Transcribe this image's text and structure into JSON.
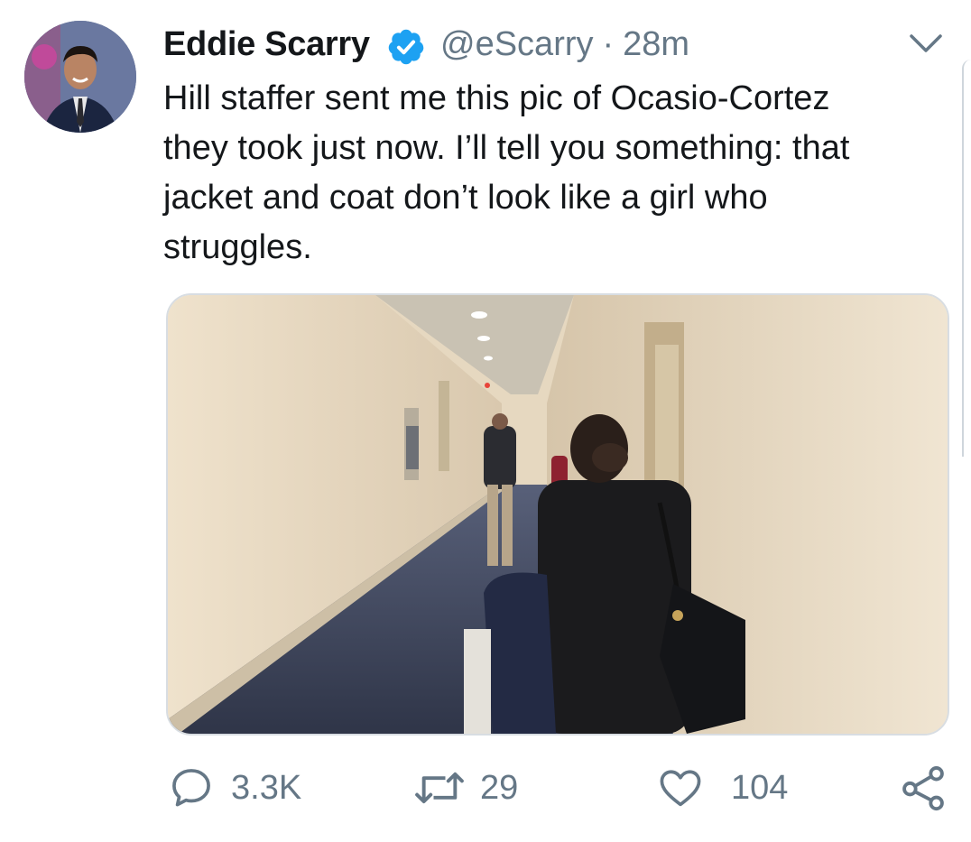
{
  "tweet": {
    "author_name": "Eddie Scarry",
    "handle": "@eScarry",
    "separator": "·",
    "time": "28m",
    "text_lines": [
      "Hill staffer sent me this pic of Ocasio-Cortez",
      "they took just now. I’ll tell you something: that",
      "jacket and coat don’t look like a girl who",
      "struggles."
    ]
  },
  "actions": {
    "replies": "3.3K",
    "retweets": "29",
    "likes": "104"
  },
  "icons": {
    "verified": "verified-badge-icon",
    "menu": "chevron-down-icon",
    "reply": "reply-icon",
    "retweet": "retweet-icon",
    "like": "heart-icon",
    "share": "share-icon"
  },
  "colors": {
    "verified_blue": "#1da1f2",
    "secondary_text": "#657786",
    "primary_text": "#14171a"
  }
}
